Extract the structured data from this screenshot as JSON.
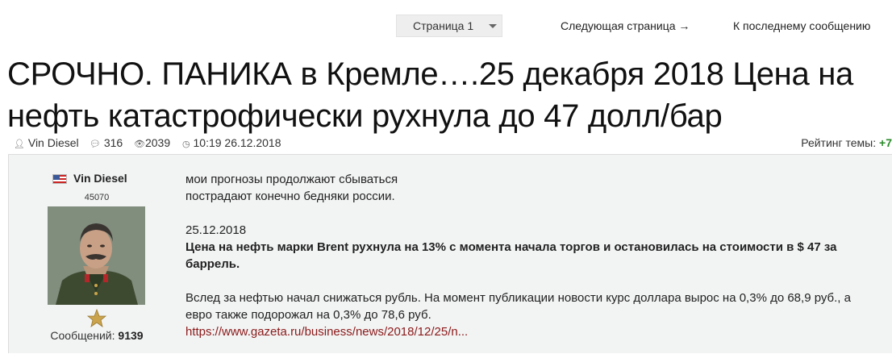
{
  "nav": {
    "page_select_label": "Страница 1",
    "next_page": "Следующая страница →",
    "last_post": "К последнему сообщению"
  },
  "thread": {
    "title": "СРОЧНО. ПАНИКА в Кремле….25 декабря 2018 Цена на нефть катастрофически рухнула до 47 долл/бар",
    "author": "Vin Diesel",
    "replies": "316",
    "views": "2039",
    "datetime": "10:19 26.12.2018",
    "rating_label": "Рейтинг темы:",
    "rating_value": "+7"
  },
  "icons": {
    "author": "user-icon",
    "replies": "comments-icon",
    "views": "eye-icon",
    "time": "clock-icon",
    "flag": "us-flag-icon",
    "rank": "star-icon"
  },
  "post": {
    "username": "Vin Diesel",
    "user_id": "45070",
    "posts_label": "Сообщений:",
    "posts_count": "9139",
    "lines": {
      "l1": "мои прогнозы продолжают сбываться",
      "l2": "пострадают конечно бедняки россии.",
      "date": "25.12.2018",
      "headline": "Цена на нефть марки Brent рухнула на 13% с момента начала торгов и остановилась на стоимости в $ 47 за баррель.",
      "body": "Вслед за нефтью начал снижаться рубль. На момент публикации новости курс доллара вырос на 0,3% до 68,9 руб., а евро также подорожал на 0,3% до 78,6 руб.",
      "link": "https://www.gazeta.ru/business/news/2018/12/25/n..."
    }
  },
  "colors": {
    "rating_positive": "#2a8a2a",
    "link": "#8b1a1a",
    "post_bg": "#f2f3f3"
  }
}
